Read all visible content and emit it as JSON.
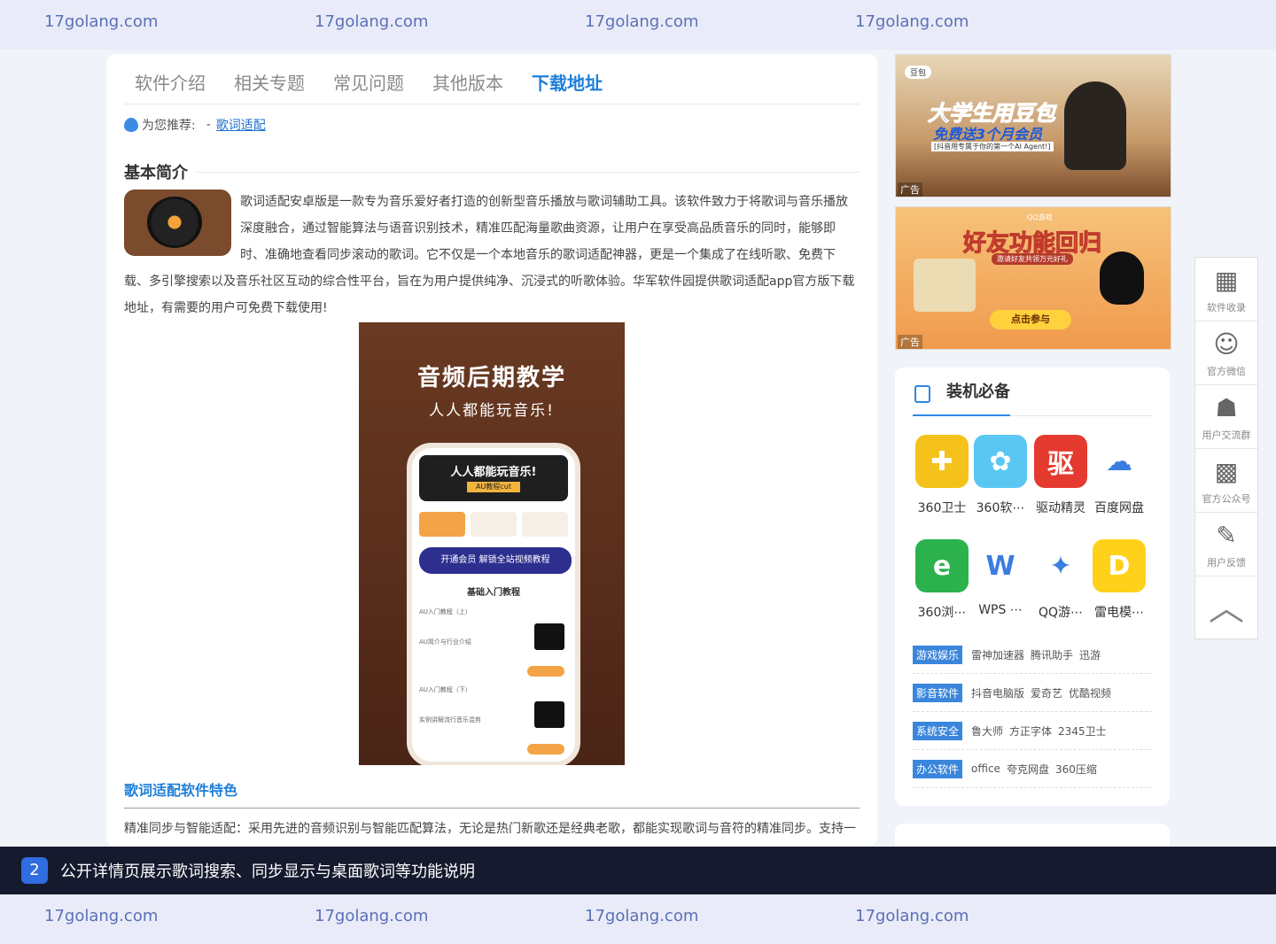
{
  "watermark": {
    "top": [
      "17golang.com",
      "17golang.com",
      "17golang.com",
      "17golang.com"
    ],
    "bottom": [
      "17golang.com",
      "17golang.com",
      "17golang.com",
      "17golang.com"
    ]
  },
  "tabs": [
    {
      "label": "软件介绍"
    },
    {
      "label": "相关专题"
    },
    {
      "label": "常见问题"
    },
    {
      "label": "其他版本"
    },
    {
      "label": "下载地址"
    }
  ],
  "recommend": {
    "label": "为您推荐:",
    "sep": "-",
    "link": "歌词适配"
  },
  "intro": {
    "title": "基本简介",
    "text": "歌词适配安卓版是一款专为音乐爱好者打造的创新型音乐播放与歌词辅助工具。该软件致力于将歌词与音乐播放深度融合，通过智能算法与语音识别技术，精准匹配海量歌曲资源，让用户在享受高品质音乐的同时，能够即时、准确地查看同步滚动的歌词。它不仅是一个本地音乐的歌词适配神器，更是一个集成了在线听歌、免费下载、多引擎搜索以及音乐社区互动的综合性平台，旨在为用户提供纯净、沉浸式的听歌体验。华军软件园提供歌词适配app官方版下载地址，有需要的用户可免费下载使用!"
  },
  "poster": {
    "title": "音频后期教学",
    "subtitle": "人人都能玩音乐!",
    "phone_banner": "人人都能玩音乐!",
    "phone_badge": "AU教程cut",
    "phone_vip": "开通会员 解锁全站视频教程",
    "phone_heading": "基础入门教程",
    "row1": "AU入门教程（上）",
    "row1_desc": "AU简介与行业介绍",
    "row2": "AU入门教程（下）",
    "row2_desc": "实例讲解流行音乐混剪"
  },
  "features": {
    "title": "歌词适配软件特色",
    "text": "精准同步与智能适配：采用先进的音频识别与智能匹配算法，无论是热门新歌还是经典老歌，都能实现歌词与音符的精准同步。支持一"
  },
  "ads": {
    "ad1": {
      "brand": "豆包",
      "headline": "大学生用豆包",
      "sub": "免费送3个月会员",
      "tagline": "[抖音用专属于你的第一个AI Agent!]",
      "label": "广告"
    },
    "ad2": {
      "brand": "QQ游戏",
      "headline": "好友功能回归",
      "sub": "邀请好友共领万元好礼",
      "cta": "点击参与",
      "label": "广告"
    }
  },
  "essential": {
    "title": "装机必备",
    "apps": [
      {
        "label": "360卫士",
        "icon": "plus-shield-icon",
        "color": "#f4c21a",
        "glyph": "✚"
      },
      {
        "label": "360软⋯",
        "icon": "flower-icon",
        "color": "#5ac7f2",
        "glyph": "✿"
      },
      {
        "label": "驱动精灵",
        "icon": "driver-icon",
        "color": "#e43a2f",
        "glyph": "驱"
      },
      {
        "label": "百度网盘",
        "icon": "cloud-icon",
        "color": "#ffffff",
        "glyph": "☁"
      },
      {
        "label": "360浏⋯",
        "icon": "browser-e-icon",
        "color": "#2bb24c",
        "glyph": "e"
      },
      {
        "label": "WPS ⋯",
        "icon": "wps-icon",
        "color": "#ffffff",
        "glyph": "W"
      },
      {
        "label": "QQ游⋯",
        "icon": "penguin-icon",
        "color": "#ffffff",
        "glyph": "✦"
      },
      {
        "label": "雷电模⋯",
        "icon": "thunder-icon",
        "color": "#ffd11a",
        "glyph": "D"
      }
    ],
    "categories": [
      {
        "tag": "游戏娱乐",
        "items": [
          "雷神加速器",
          "腾讯助手",
          "迅游"
        ]
      },
      {
        "tag": "影音软件",
        "items": [
          "抖音电脑版",
          "爱奇艺",
          "优酷视频"
        ]
      },
      {
        "tag": "系统安全",
        "items": [
          "鲁大师",
          "方正字体",
          "2345卫士"
        ]
      },
      {
        "tag": "办公软件",
        "items": [
          "office",
          "夸克网盘",
          "360压缩"
        ]
      }
    ]
  },
  "floatbar": [
    {
      "label": "软件收录",
      "glyph": "▦"
    },
    {
      "label": "官方微信",
      "glyph": "☺"
    },
    {
      "label": "用户交流群",
      "glyph": "☗"
    },
    {
      "label": "官方公众号",
      "glyph": "▩"
    },
    {
      "label": "用户反馈",
      "glyph": "✎"
    }
  ],
  "back_to_top": "︿",
  "bottom_banner": {
    "num": "2",
    "text": "公开详情页展示歌词搜索、同步显示与桌面歌词等功能说明"
  }
}
